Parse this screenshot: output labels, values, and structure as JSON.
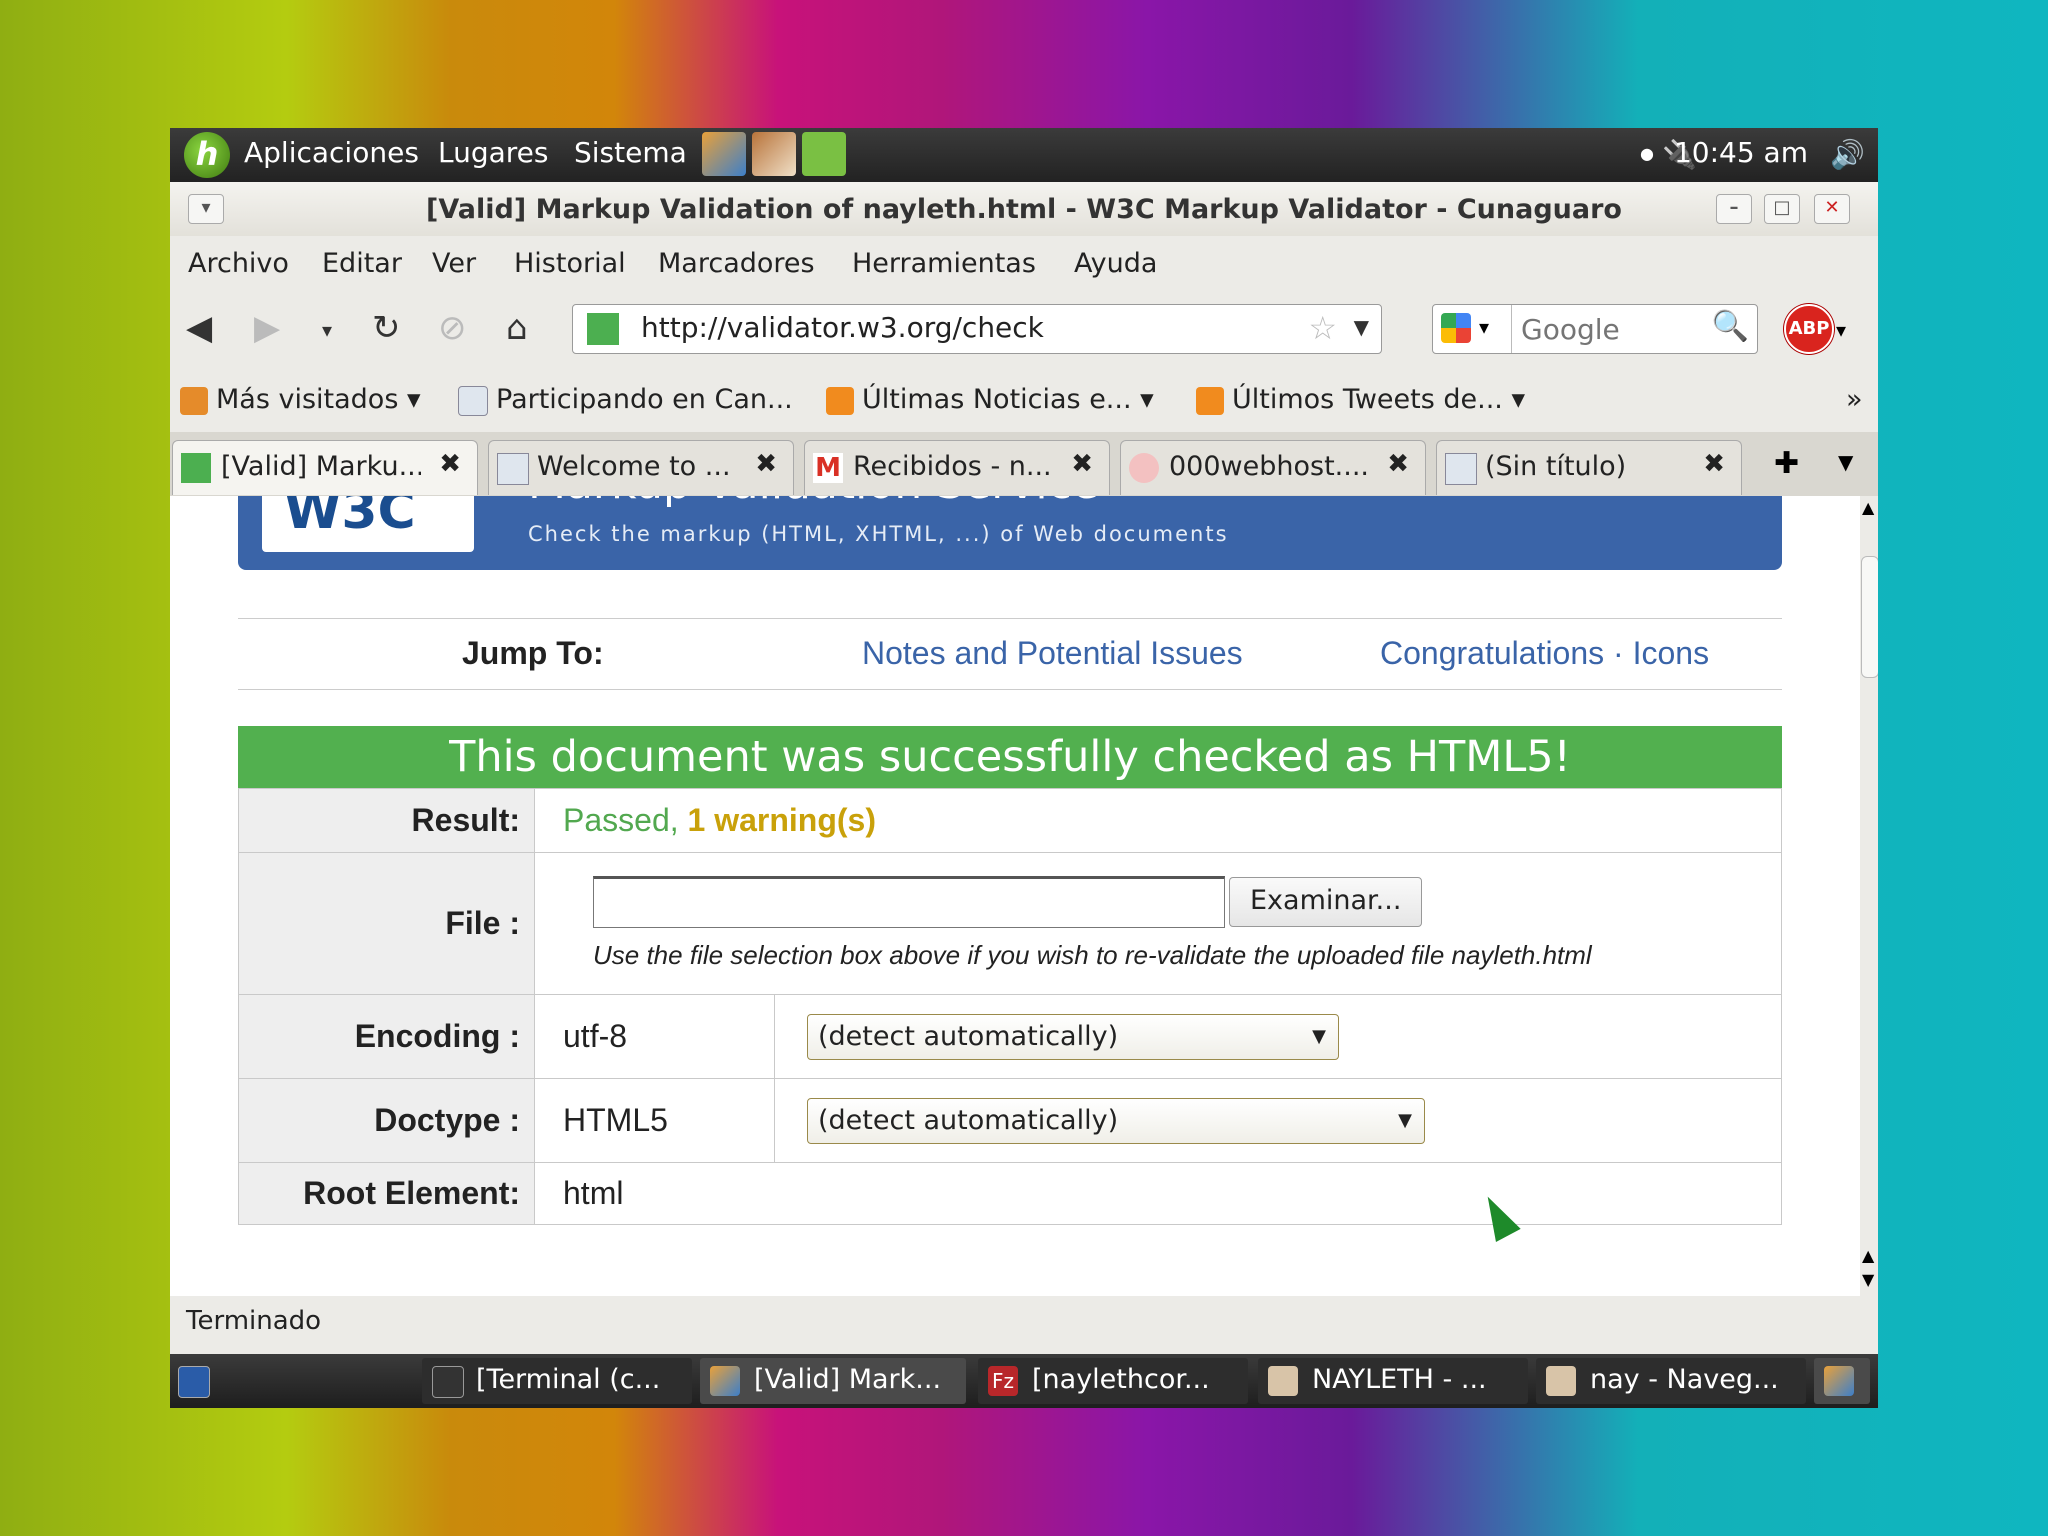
{
  "top_panel": {
    "menus": [
      "Aplicaciones",
      "Lugares",
      "Sistema"
    ],
    "clock": "10:45 am"
  },
  "window": {
    "title": "[Valid] Markup Validation of nayleth.html - W3C Markup Validator - Cunaguaro"
  },
  "menubar": [
    "Archivo",
    "Editar",
    "Ver",
    "Historial",
    "Marcadores",
    "Herramientas",
    "Ayuda"
  ],
  "navbar": {
    "url": "http://validator.w3.org/check",
    "search_placeholder": "Google"
  },
  "bookmarks": [
    "Más visitados ▾",
    "Participando en Can...",
    "Últimas Noticias e... ▾",
    "Últimos Tweets de... ▾"
  ],
  "tabs": [
    {
      "label": "[Valid] Marku..."
    },
    {
      "label": "Welcome to ..."
    },
    {
      "label": "Recibidos - n..."
    },
    {
      "label": "000webhost...."
    },
    {
      "label": "(Sin título)"
    }
  ],
  "page": {
    "banner_title": "Markup Validation Service",
    "banner_sub": "Check the markup (HTML, XHTML, ...) of Web documents",
    "jump_label": "Jump To:",
    "jump_links": [
      "Notes and Potential Issues",
      "Congratulations · Icons"
    ],
    "success": "This document was successfully checked as HTML5!",
    "result_label": "Result:",
    "result_passed": "Passed,",
    "result_warning": "1 warning(s)",
    "file_label": "File :",
    "file_button": "Examinar...",
    "file_hint": "Use the file selection box above if you wish to re-validate the uploaded file nayleth.html",
    "encoding_label": "Encoding :",
    "encoding_value": "utf-8",
    "encoding_select": "(detect automatically)",
    "doctype_label": "Doctype :",
    "doctype_value": "HTML5",
    "doctype_select": "(detect automatically)",
    "root_label": "Root Element:",
    "root_value": "html"
  },
  "statusbar": "Terminado",
  "taskbar": [
    "[Terminal (c...",
    "[Valid] Mark...",
    "[naylethcor...",
    "NAYLETH - ...",
    "nay - Naveg..."
  ]
}
